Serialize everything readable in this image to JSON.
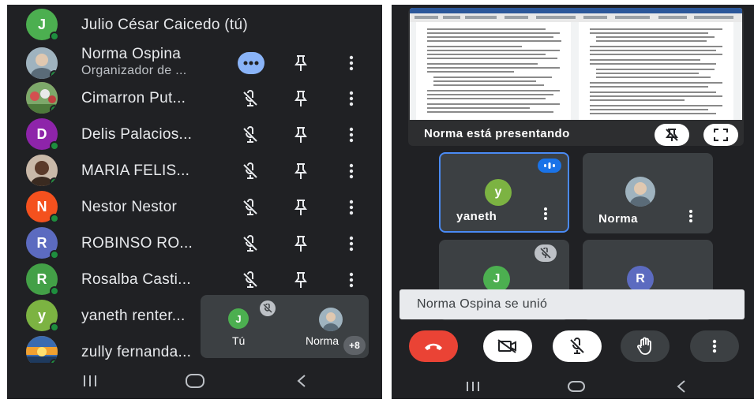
{
  "left_panel": {
    "participants": [
      {
        "name": "Julio César Caicedo (tú)",
        "subtitle": "",
        "initial": "J",
        "color": "#4caf50",
        "photo": false
      },
      {
        "name": "Norma Ospina",
        "subtitle": "Organizador de ...",
        "initial": "",
        "color": "#8c9aa5",
        "photo": true
      },
      {
        "name": "Cimarron Put...",
        "subtitle": "",
        "initial": "",
        "color": "#c85a5a",
        "photo": true
      },
      {
        "name": "Delis Palacios...",
        "subtitle": "",
        "initial": "D",
        "color": "#8e24aa",
        "photo": false
      },
      {
        "name": "MARIA FELIS...",
        "subtitle": "",
        "initial": "",
        "color": "#6b4b3e",
        "photo": true
      },
      {
        "name": "Nestor Nestor",
        "subtitle": "",
        "initial": "N",
        "color": "#f4511e",
        "photo": false
      },
      {
        "name": "ROBINSO RO...",
        "subtitle": "",
        "initial": "R",
        "color": "#5c6bc0",
        "photo": false
      },
      {
        "name": "Rosalba Casti...",
        "subtitle": "",
        "initial": "R",
        "color": "#43a047",
        "photo": false
      },
      {
        "name": "yaneth renter...",
        "subtitle": "",
        "initial": "y",
        "color": "#7cb342",
        "photo": false
      },
      {
        "name": "zully fernanda...",
        "subtitle": "",
        "initial": "",
        "color": "#e0a040",
        "photo": true
      }
    ],
    "mini_tile": {
      "self_label": "Tú",
      "self_initial": "J",
      "other_label": "Norma",
      "more_count": "+8"
    }
  },
  "right_panel": {
    "presentation_label": "Norma está presentando",
    "tiles": [
      {
        "name": "yaneth",
        "initial": "y",
        "color": "#7cb342",
        "active": true
      },
      {
        "name": "Norma",
        "initial": "",
        "color": "#8c9aa5",
        "active": false
      },
      {
        "name": "",
        "initial": "J",
        "color": "#4caf50",
        "active": false
      },
      {
        "name": "",
        "initial": "R",
        "color": "#5c6bc0",
        "active": false
      }
    ],
    "notification": "Norma Ospina se unió"
  },
  "colors": {
    "background": "#202124",
    "tile": "#3c4043",
    "accent_blue": "#8ab4f8",
    "end_call_red": "#ea4335"
  }
}
